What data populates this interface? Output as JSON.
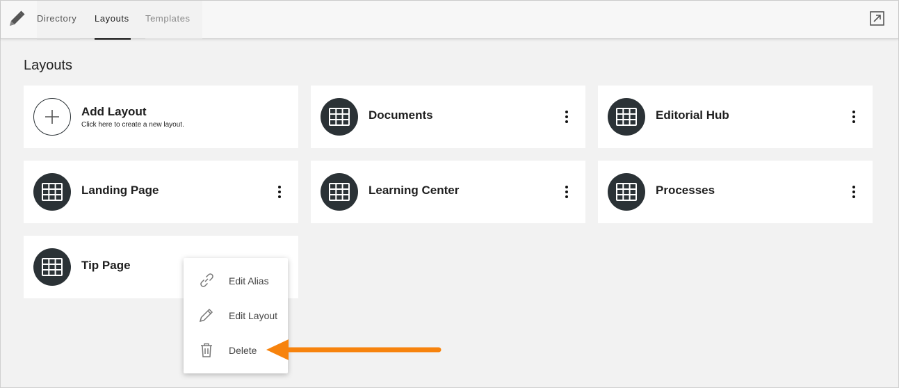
{
  "header": {
    "tabs": [
      {
        "label": "Directory"
      },
      {
        "label": "Layouts"
      },
      {
        "label": "Templates"
      }
    ],
    "logo_icon": "pencil-icon",
    "action_icon": "open-external-icon"
  },
  "main": {
    "title": "Layouts",
    "add_card": {
      "title": "Add Layout",
      "subtitle": "Click here to create a new layout."
    },
    "layouts": [
      {
        "title": "Documents"
      },
      {
        "title": "Editorial Hub"
      },
      {
        "title": "Landing Page"
      },
      {
        "title": "Learning Center"
      },
      {
        "title": "Processes"
      },
      {
        "title": "Tip Page"
      }
    ]
  },
  "context_menu": {
    "items": [
      {
        "label": "Edit Alias",
        "icon": "link-icon"
      },
      {
        "label": "Edit Layout",
        "icon": "pencil-icon"
      },
      {
        "label": "Delete",
        "icon": "trash-icon"
      }
    ]
  },
  "colors": {
    "accent_arrow": "#f7830d",
    "icon_circle": "#2b3236"
  }
}
